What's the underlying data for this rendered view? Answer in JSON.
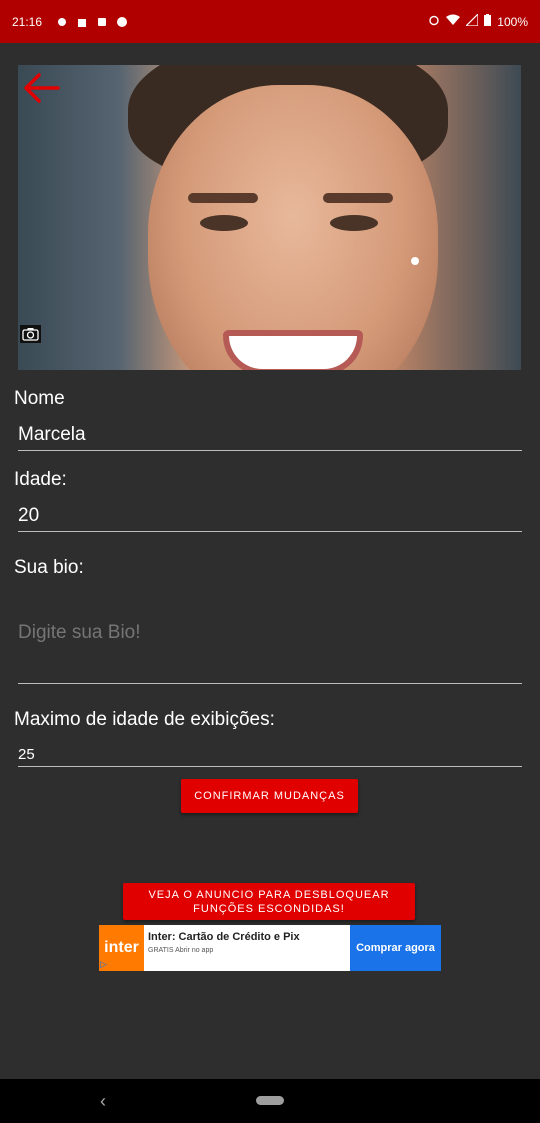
{
  "status_bar": {
    "time": "21:16",
    "battery": "100%"
  },
  "form": {
    "name_label": "Nome",
    "name_value": "Marcela",
    "age_label": "Idade:",
    "age_value": "20",
    "bio_label": "Sua bio:",
    "bio_placeholder": "Digite sua Bio!",
    "max_age_label": "Maximo de idade de exibições:",
    "max_age_value": "25",
    "confirm_button": "CONFIRMAR MUDANÇAS"
  },
  "unlock_button": "VEJA O ANUNCIO PARA DESBLOQUEAR FUNÇÕES ESCONDIDAS!",
  "ad": {
    "logo": "inter",
    "title": "Inter: Cartão de Crédito e Pix",
    "subtitle": "GRATIS  Abrir no app",
    "cta": "Comprar agora"
  },
  "colors": {
    "accent": "#e00000",
    "status_bar": "#b00000",
    "background": "#2e2e2e"
  },
  "icons": [
    "back-arrow-icon",
    "camera-icon",
    "alarm-icon",
    "wifi-icon",
    "signal-icon",
    "battery-icon"
  ]
}
